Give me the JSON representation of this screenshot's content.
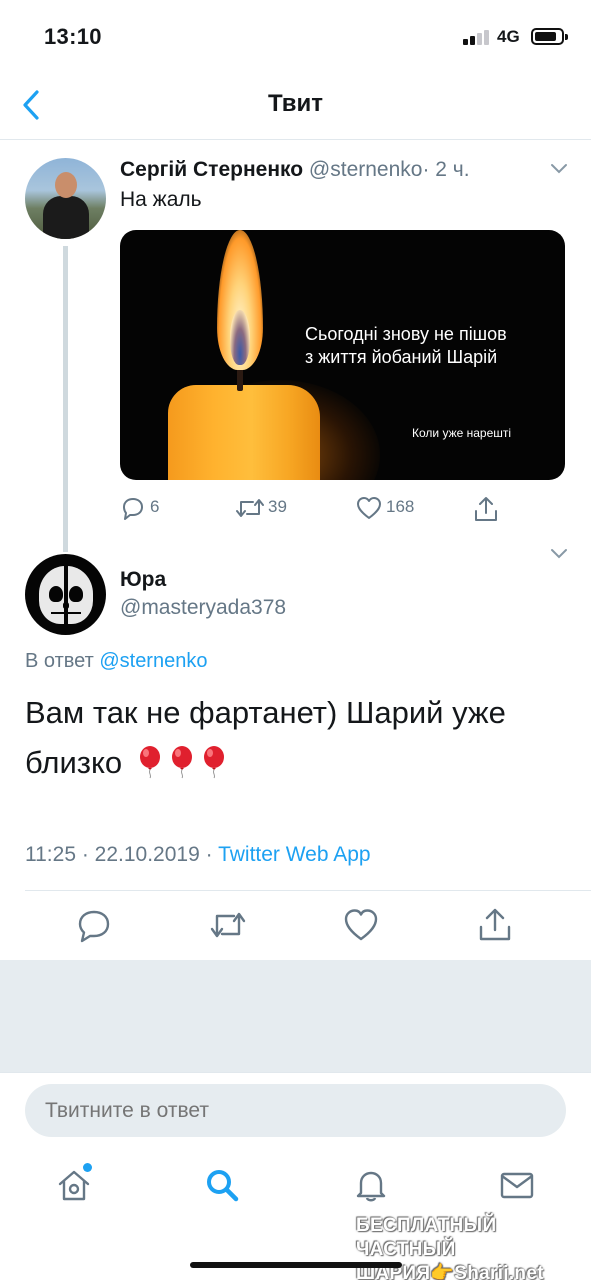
{
  "status_bar": {
    "time": "13:10",
    "network": "4G"
  },
  "nav": {
    "title": "Твит"
  },
  "parent_tweet": {
    "author_name": "Сергій Стерненко",
    "author_handle": "@sternenko",
    "time_ago": "· 2 ч.",
    "text": "На жаль",
    "media": {
      "line1": "Сьогодні знову не пішов",
      "line2": "з життя йобаний Шарій",
      "small": "Коли уже нарешті"
    },
    "replies": "6",
    "retweets": "39",
    "likes": "168"
  },
  "main_tweet": {
    "author_name": "Юра",
    "author_handle": "@masteryada378",
    "reply_prefix": "В ответ",
    "reply_to": "@sternenko",
    "text": "Вам так не фартанет) Шарий уже близко",
    "timestamp": "11:25 · 22.10.2019 ·",
    "app": "Twitter Web App"
  },
  "reply_bar": {
    "placeholder": "Твитните в ответ"
  },
  "watermark": {
    "line1": "БЕСПЛАТНЫЙ ЧАСТНЫЙ",
    "line2": "ШАРИЯ👉Sharij.net"
  },
  "colors": {
    "accent": "#1da1f2",
    "muted": "#657786",
    "band": "#e6ecf0"
  }
}
